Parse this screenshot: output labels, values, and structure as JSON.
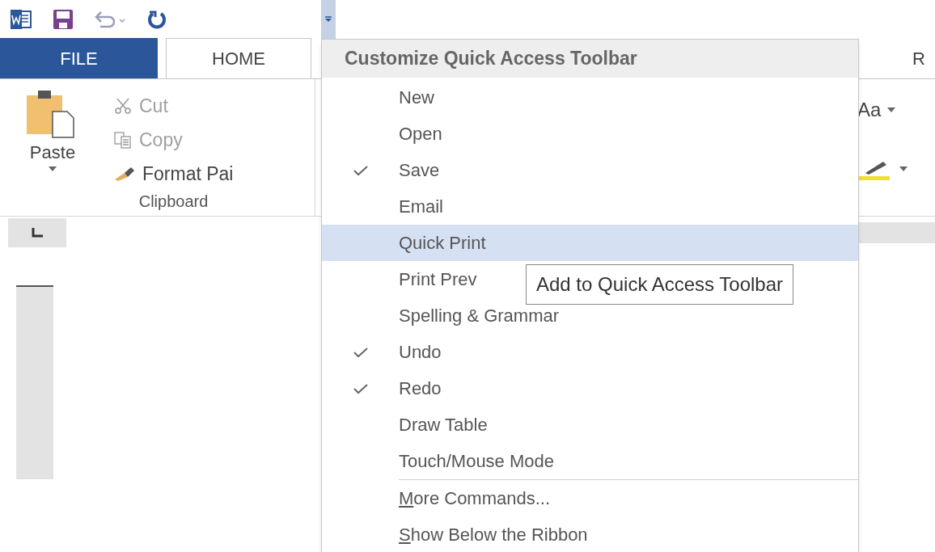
{
  "tabs": [
    {
      "label": "FILE",
      "kind": "file",
      "selected": false
    },
    {
      "label": "HOME",
      "kind": "tab",
      "selected": true
    },
    {
      "label": "R",
      "kind": "tab",
      "selected": false
    }
  ],
  "clipboard": {
    "paste": "Paste",
    "commands": [
      {
        "label": "Cut",
        "kind": "cut",
        "disabled": true
      },
      {
        "label": "Copy",
        "kind": "copy",
        "disabled": true
      },
      {
        "label": "Format Pai",
        "kind": "painter",
        "disabled": false
      }
    ],
    "group_label": "Clipboard"
  },
  "styles_partial": {
    "label": "Aa"
  },
  "menu": {
    "title": "Customize Quick Access Toolbar",
    "items": [
      {
        "kind": "check",
        "label": "New",
        "checked": false,
        "selected": false
      },
      {
        "kind": "check",
        "label": "Open",
        "checked": false,
        "selected": false
      },
      {
        "kind": "check",
        "label": "Save",
        "checked": true,
        "selected": false
      },
      {
        "kind": "check",
        "label": "Email",
        "checked": false,
        "selected": false
      },
      {
        "kind": "check",
        "label": "Quick Print",
        "checked": false,
        "selected": true
      },
      {
        "kind": "check",
        "label": "Print Prev",
        "checked": false,
        "selected": false
      },
      {
        "kind": "check",
        "label": "Spelling & Grammar",
        "checked": false,
        "selected": false
      },
      {
        "kind": "check",
        "label": "Undo",
        "checked": true,
        "selected": false
      },
      {
        "kind": "check",
        "label": "Redo",
        "checked": true,
        "selected": false
      },
      {
        "kind": "check",
        "label": "Draw Table",
        "checked": false,
        "selected": false
      },
      {
        "kind": "check",
        "label": "Touch/Mouse Mode",
        "checked": false,
        "selected": false
      },
      {
        "kind": "command",
        "mnemonic": "M",
        "rest": "ore Commands...",
        "selected": false
      },
      {
        "kind": "command",
        "mnemonic": "S",
        "rest": "how Below the Ribbon",
        "selected": false
      }
    ],
    "tooltip": "Add to Quick Access Toolbar"
  }
}
